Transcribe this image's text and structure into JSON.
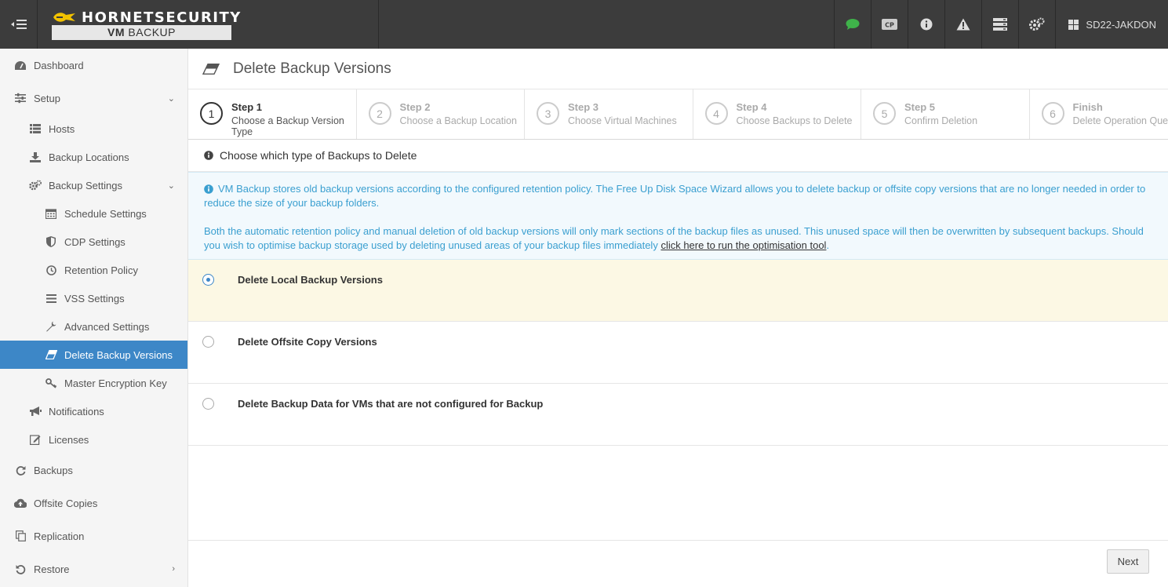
{
  "topbar": {
    "brand_name": "HORNETSECURITY",
    "product_prefix": "VM",
    "product_name": "BACKUP",
    "icons": [
      "chat-icon",
      "cp-icon",
      "info-icon",
      "warning-icon",
      "server-icon",
      "settings-icon"
    ],
    "cp_label": "CP",
    "user": "SD22-JAKDON",
    "accent_green": "#3fb24a"
  },
  "sidebar": {
    "items": [
      {
        "label": "Dashboard",
        "icon": "dashboard-icon"
      },
      {
        "label": "Setup",
        "icon": "wrench-icon"
      },
      {
        "label": "Hosts",
        "icon": "list-icon"
      },
      {
        "label": "Backup Locations",
        "icon": "download-icon"
      },
      {
        "label": "Backup Settings",
        "icon": "cogs-icon"
      },
      {
        "label": "Schedule Settings",
        "icon": "calendar-icon"
      },
      {
        "label": "CDP Settings",
        "icon": "shield-icon"
      },
      {
        "label": "Retention Policy",
        "icon": "clock-icon"
      },
      {
        "label": "VSS Settings",
        "icon": "bars-icon"
      },
      {
        "label": "Advanced Settings",
        "icon": "wrench-icon"
      },
      {
        "label": "Delete Backup Versions",
        "icon": "eraser-icon"
      },
      {
        "label": "Master Encryption Key",
        "icon": "key-icon"
      },
      {
        "label": "Notifications",
        "icon": "bullhorn-icon"
      },
      {
        "label": "Licenses",
        "icon": "edit-icon"
      },
      {
        "label": "Backups",
        "icon": "refresh-icon"
      },
      {
        "label": "Offsite Copies",
        "icon": "cloud-upload-icon"
      },
      {
        "label": "Replication",
        "icon": "copy-icon"
      },
      {
        "label": "Restore",
        "icon": "undo-icon"
      }
    ],
    "active_color": "#3d87c7"
  },
  "main": {
    "title": "Delete Backup Versions",
    "steps": [
      {
        "num": "1",
        "label": "Step 1",
        "desc": "Choose a Backup Version Type"
      },
      {
        "num": "2",
        "label": "Step 2",
        "desc": "Choose a Backup Location"
      },
      {
        "num": "3",
        "label": "Step 3",
        "desc": "Choose Virtual Machines"
      },
      {
        "num": "4",
        "label": "Step 4",
        "desc": "Choose Backups to Delete"
      },
      {
        "num": "5",
        "label": "Step 5",
        "desc": "Confirm Deletion"
      },
      {
        "num": "6",
        "label": "Finish",
        "desc": "Delete Operation Que"
      }
    ],
    "section_title": "Choose which type of Backups to Delete",
    "info": {
      "p1": "VM Backup stores old backup versions according to the configured retention policy. The Free Up Disk Space Wizard allows you to delete backup or offsite copy versions that are no longer needed in order to reduce the size of your backup folders.",
      "p2_text": "Both the automatic retention policy and manual deletion of old backup versions will only mark sections of the backup files as unused. This unused space will then be overwritten by subsequent backups. Should you wish to optimise backup storage used by deleting unused areas of your backup files immediately ",
      "p2_link": "click here to run the optimisation tool",
      "p2_end": ".",
      "color": "#3a9fd0"
    },
    "options": [
      {
        "label": "Delete Local Backup Versions",
        "selected": true
      },
      {
        "label": "Delete Offsite Copy Versions",
        "selected": false
      },
      {
        "label": "Delete Backup Data for VMs that are not configured for Backup",
        "selected": false
      }
    ],
    "next_label": "Next"
  }
}
